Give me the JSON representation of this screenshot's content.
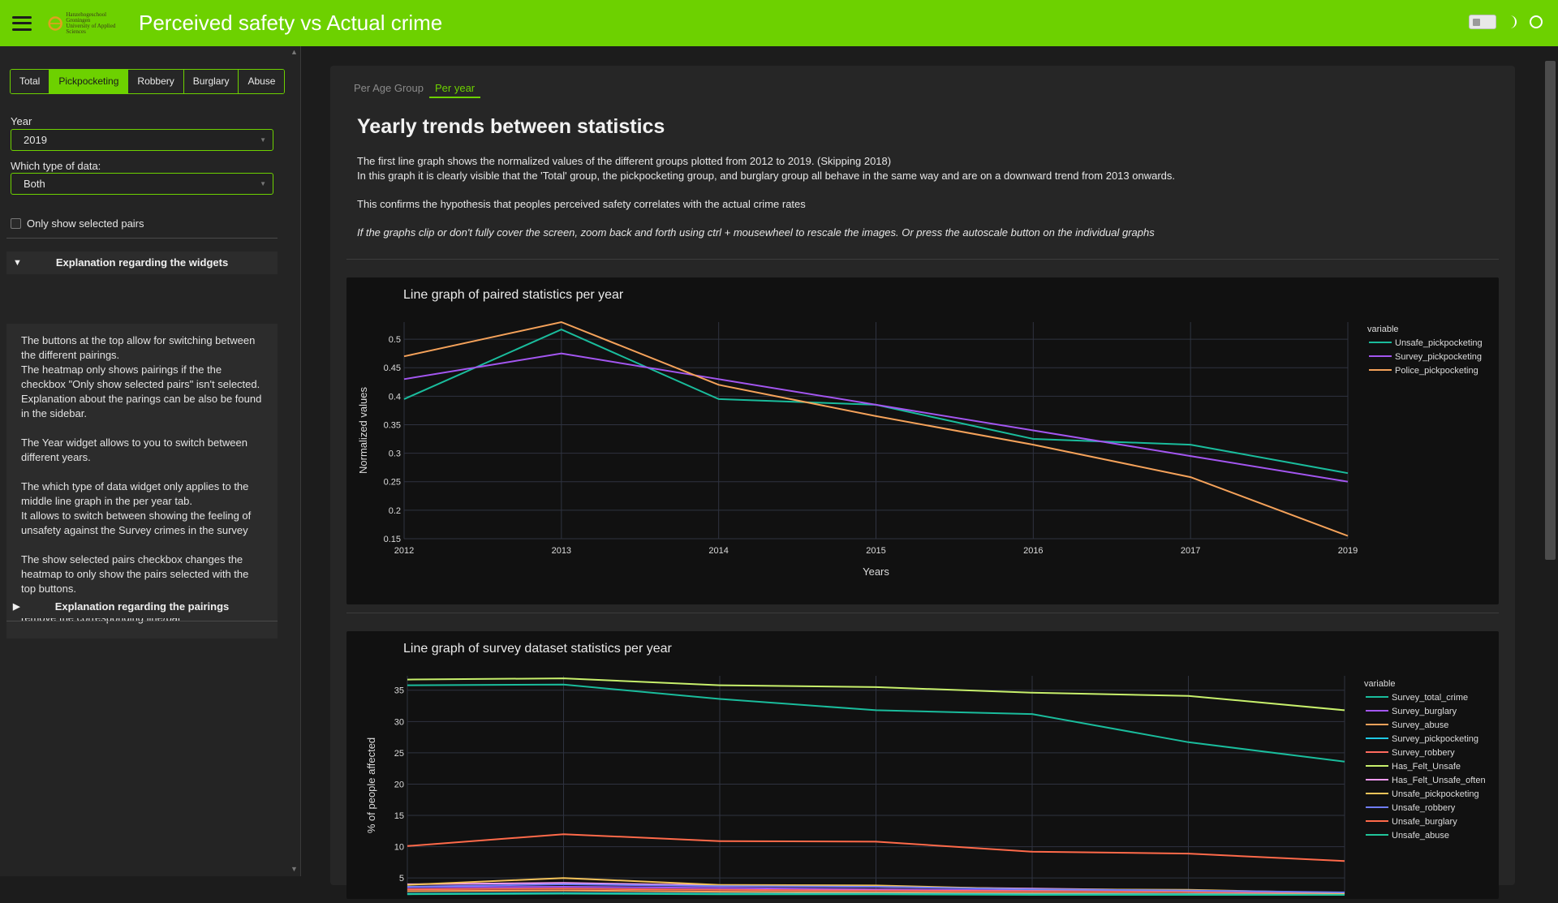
{
  "header": {
    "title": "Perceived safety vs Actual crime",
    "logo_text": [
      "Hanzehogeschool",
      "Groningen",
      "University of Applied Sciences"
    ]
  },
  "sidebar": {
    "pair_tabs": [
      {
        "label": "Total",
        "active": false
      },
      {
        "label": "Pickpocketing",
        "active": true
      },
      {
        "label": "Robbery",
        "active": false
      },
      {
        "label": "Burglary",
        "active": false
      },
      {
        "label": "Abuse",
        "active": false
      }
    ],
    "year_label": "Year",
    "year_value": "2019",
    "data_type_label": "Which type of data:",
    "data_type_value": "Both",
    "only_pairs_label": "Only show selected pairs",
    "only_pairs_checked": false,
    "widgets_accordion_title": "Explanation regarding the widgets",
    "widgets_paragraphs": [
      "The buttons at the top allow for switching between the different pairings.\nThe heatmap only shows pairings if the the checkbox \"Only show selected pairs\" isn't selected.\nExplanation about the parings can be also be found in the sidebar.",
      "The Year widget allows to you to switch between different years.",
      "The which type of data widget only applies to the middle line graph in the per year tab.\nIt allows to switch between showing the feeling of unsafety against the Survey crimes in the survey",
      "The show selected pairs checkbox changes the heatmap to only show the pairs selected with the top buttons.\nIn addition, when clicking a label in a graph it will remove the corresponding line/bar"
    ],
    "pairings_accordion_title": "Explanation regarding the pairings"
  },
  "main": {
    "tabs": [
      {
        "label": "Per Age Group",
        "active": false
      },
      {
        "label": "Per year",
        "active": true
      }
    ],
    "section_title": "Yearly trends between statistics",
    "desc_line1": "The first line graph shows the normalized values of the different groups plotted from 2012 to 2019. (Skipping 2018)",
    "desc_line2": "In this graph it is clearly visible that the 'Total' group, the pickpocketing group, and burglary group all behave in the same way and are on a downward trend from 2013 onwards.",
    "desc_line3": "This confirms the hypothesis that peoples perceived safety correlates with the actual crime rates",
    "desc_line4": "If the graphs clip or don't fully cover the screen, zoom back and forth using ctrl + mousewheel to rescale the images. Or press the autoscale button on the individual graphs"
  },
  "colors": {
    "accent": "#6dd100",
    "background": "#1c1c1c",
    "panel": "#262626",
    "plot_bg": "#111111"
  },
  "chart_data": [
    {
      "type": "line",
      "title": "Line graph of paired statistics per year",
      "xlabel": "Years",
      "ylabel": "Normalized values",
      "x": [
        "2012",
        "2013",
        "2014",
        "2015",
        "2016",
        "2017",
        "2019"
      ],
      "ylim": [
        0.15,
        0.53
      ],
      "yticks": [
        0.15,
        0.2,
        0.25,
        0.3,
        0.35,
        0.4,
        0.45,
        0.5
      ],
      "ytick_labels": [
        "0.15",
        "0.2",
        "0.25",
        "0.3",
        "0.35",
        "0.4",
        "0.45",
        "0.5"
      ],
      "legend_title": "variable",
      "legend_position": "right",
      "grid": true,
      "series": [
        {
          "name": "Unsafe_pickpocketing",
          "color": "#1abc9c",
          "values": [
            0.395,
            0.517,
            0.395,
            0.385,
            0.325,
            0.315,
            0.265
          ]
        },
        {
          "name": "Survey_pickpocketing",
          "color": "#a356f0",
          "values": [
            0.43,
            0.475,
            0.43,
            0.385,
            0.34,
            0.295,
            0.25
          ]
        },
        {
          "name": "Police_pickpocketing",
          "color": "#f5a25a",
          "values": [
            0.47,
            0.53,
            0.42,
            0.365,
            0.315,
            0.258,
            0.155
          ]
        }
      ]
    },
    {
      "type": "line",
      "title": "Line graph of survey dataset statistics per year",
      "xlabel": "",
      "ylabel": "% of people affected",
      "x": [
        "2012",
        "2013",
        "2014",
        "2015",
        "2016",
        "2017",
        "2019"
      ],
      "ylim": [
        2.3,
        37.3
      ],
      "yticks": [
        5,
        10,
        15,
        20,
        25,
        30,
        35
      ],
      "ytick_labels": [
        "5",
        "10",
        "15",
        "20",
        "25",
        "30",
        "35"
      ],
      "legend_title": "variable",
      "legend_position": "right",
      "grid": true,
      "series": [
        {
          "name": "Survey_total_crime",
          "color": "#1abc9c",
          "values": [
            35.8,
            35.9,
            33.6,
            31.8,
            31.2,
            26.7,
            23.6
          ]
        },
        {
          "name": "Survey_burglary",
          "color": "#a356f0",
          "values": [
            3.5,
            3.6,
            3.4,
            3.2,
            3.0,
            2.8,
            2.5
          ]
        },
        {
          "name": "Survey_abuse",
          "color": "#f5a25a",
          "values": [
            2.9,
            3.0,
            2.8,
            2.7,
            2.6,
            2.5,
            2.4
          ]
        },
        {
          "name": "Survey_pickpocketing",
          "color": "#1fc8e3",
          "values": [
            2.5,
            2.6,
            2.5,
            2.5,
            2.4,
            2.4,
            2.3
          ]
        },
        {
          "name": "Survey_robbery",
          "color": "#ff6a5e",
          "values": [
            3.2,
            3.3,
            3.1,
            3.0,
            2.9,
            2.8,
            2.6
          ]
        },
        {
          "name": "Has_Felt_Unsafe",
          "color": "#c8f06c",
          "values": [
            36.7,
            36.9,
            35.8,
            35.5,
            34.6,
            34.1,
            31.8
          ]
        },
        {
          "name": "Has_Felt_Unsafe_often",
          "color": "#f59bf5",
          "values": [
            4.0,
            4.2,
            3.8,
            3.6,
            3.3,
            3.0,
            2.6
          ]
        },
        {
          "name": "Unsafe_pickpocketing",
          "color": "#f5c45a",
          "values": [
            3.9,
            5.0,
            3.9,
            3.8,
            3.2,
            3.1,
            2.6
          ]
        },
        {
          "name": "Unsafe_robbery",
          "color": "#6f7cf5",
          "values": [
            3.6,
            4.0,
            3.7,
            3.6,
            3.2,
            3.0,
            2.7
          ]
        },
        {
          "name": "Unsafe_burglary",
          "color": "#ff6a4a",
          "values": [
            10.1,
            12.0,
            10.9,
            10.8,
            9.2,
            8.9,
            7.7
          ]
        },
        {
          "name": "Unsafe_abuse",
          "color": "#21c49a",
          "values": [
            2.4,
            2.5,
            2.4,
            2.4,
            2.3,
            2.3,
            2.3
          ]
        }
      ]
    }
  ]
}
